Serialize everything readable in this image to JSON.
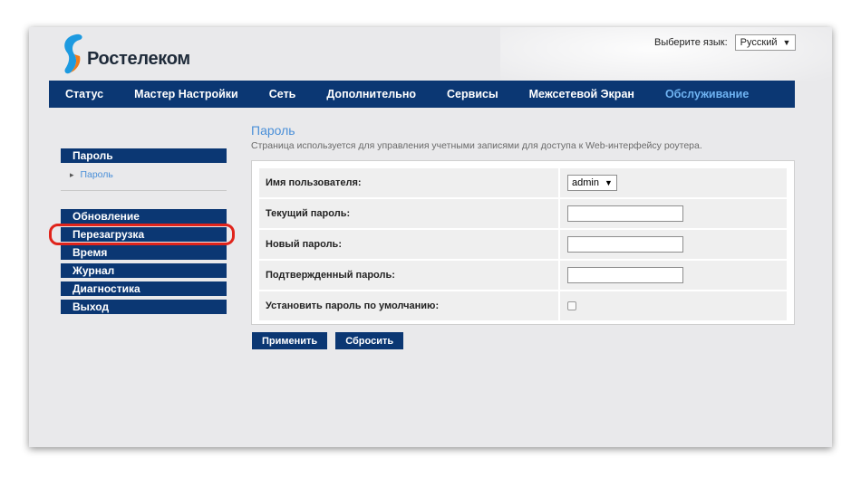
{
  "brand": {
    "name": "Ростелеком"
  },
  "language": {
    "label": "Выберите язык:",
    "selected": "Русский"
  },
  "topnav": {
    "items": [
      {
        "label": "Статус"
      },
      {
        "label": "Мастер Настройки"
      },
      {
        "label": "Сеть"
      },
      {
        "label": "Дополнительно"
      },
      {
        "label": "Сервисы"
      },
      {
        "label": "Межсетевой Экран"
      },
      {
        "label": "Обслуживание"
      }
    ],
    "active_index": 6
  },
  "sidebar": {
    "group1": {
      "header": "Пароль",
      "sub": "Пароль"
    },
    "items": [
      {
        "label": "Обновление"
      },
      {
        "label": "Перезагрузка"
      },
      {
        "label": "Время"
      },
      {
        "label": "Журнал"
      },
      {
        "label": "Диагностика"
      },
      {
        "label": "Выход"
      }
    ],
    "highlighted_index": 1
  },
  "main": {
    "title": "Пароль",
    "description": "Страница используется для управления учетными записями для доступа к Web-интерфейсу роутера.",
    "fields": {
      "username": {
        "label": "Имя пользователя:",
        "value": "admin"
      },
      "current_password": {
        "label": "Текущий пароль:",
        "value": ""
      },
      "new_password": {
        "label": "Новый пароль:",
        "value": ""
      },
      "confirm_password": {
        "label": "Подтвержденный пароль:",
        "value": ""
      },
      "default_password": {
        "label": "Установить пароль по умолчанию:",
        "checked": false
      }
    },
    "apply_label": "Применить",
    "reset_label": "Сбросить"
  },
  "colors": {
    "nav_bg": "#0b3773",
    "active_link": "#6fb3f2",
    "highlight": "#e0241b"
  }
}
